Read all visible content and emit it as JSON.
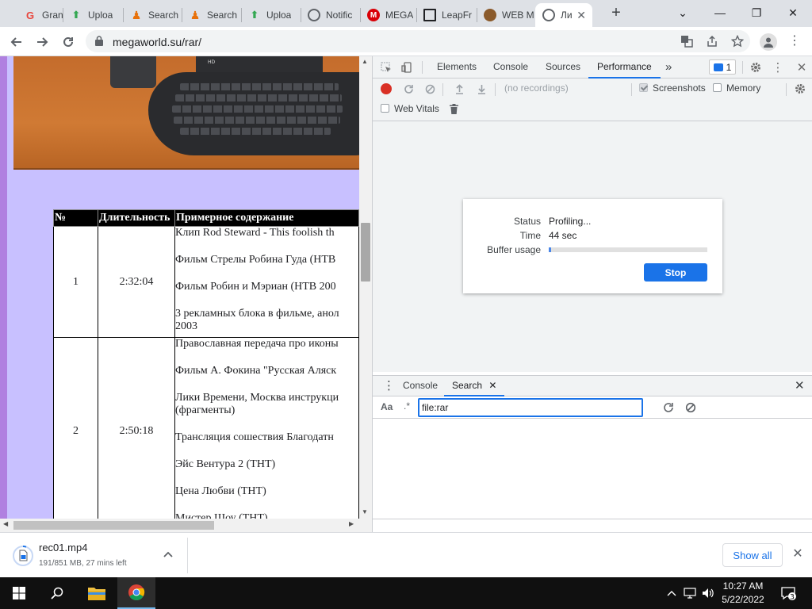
{
  "browser": {
    "tabs": [
      {
        "title": "Grand",
        "favicon": "grand-icon",
        "color": "#e8453c"
      },
      {
        "title": "Uploa",
        "favicon": "upload-icon",
        "color": "#34a853"
      },
      {
        "title": "Search",
        "favicon": "search-person-icon",
        "color": "#e8710a"
      },
      {
        "title": "Search",
        "favicon": "search-person-icon",
        "color": "#e8710a"
      },
      {
        "title": "Uploa",
        "favicon": "upload-icon",
        "color": "#34a853"
      },
      {
        "title": "Notific",
        "favicon": "globe-icon",
        "color": "#5f6368"
      },
      {
        "title": "MEGA",
        "favicon": "mega-icon",
        "color": "#d90007"
      },
      {
        "title": "LeapFr",
        "favicon": "museum-icon",
        "color": "#202124"
      },
      {
        "title": "WEB M",
        "favicon": "eye-icon",
        "color": "#8a5a2b"
      },
      {
        "title": "Ли",
        "favicon": "globe-icon",
        "color": "#5f6368",
        "active": true
      }
    ],
    "url": "megaworld.su/rar/"
  },
  "page": {
    "photo_label": "HD",
    "table": {
      "headers": [
        "№",
        "Длительность",
        "Примерное содержание"
      ],
      "rows": [
        {
          "num": "1",
          "duration": "2:32:04",
          "items": [
            "Клип Rod Steward - This foolish th",
            "Фильм Стрелы Робина Гуда (НТВ",
            "Фильм Робин и Мэриан (НТВ 200",
            "3 рекламных блока в фильме, анол\n2003"
          ]
        },
        {
          "num": "2",
          "duration": "2:50:18",
          "items": [
            "Православная передача про иконы",
            "Фильм А. Фокина \"Русская Аляск",
            "Лики Времени, Москва инструкци\n(фрагменты)",
            "Трансляция сошествия Благодатн",
            "Эйс Вентура 2 (ТНТ)",
            "Цена Любви (ТНТ)",
            "Мистер Шоу (ТНТ)"
          ]
        }
      ]
    }
  },
  "devtools": {
    "tabs": [
      "Elements",
      "Console",
      "Sources",
      "Performance"
    ],
    "active_tab": "Performance",
    "issues_count": "1",
    "recordings_placeholder": "(no recordings)",
    "screenshots_label": "Screenshots",
    "memory_label": "Memory",
    "web_vitals_label": "Web Vitals",
    "status": {
      "status_label": "Status",
      "status_value": "Profiling...",
      "time_label": "Time",
      "time_value": "44 sec",
      "buffer_label": "Buffer usage",
      "buffer_fraction": 0.015,
      "stop_label": "Stop"
    },
    "drawer": {
      "tabs": [
        "Console",
        "Search"
      ],
      "active_tab": "Search",
      "case_label": "Aa",
      "regex_label": ".*",
      "search_value": "file:rar"
    }
  },
  "downloads": {
    "filename": "rec01.mp4",
    "status": "191/851 MB, 27 mins left",
    "show_all_label": "Show all"
  },
  "taskbar": {
    "time": "10:27 AM",
    "date": "5/22/2022",
    "notifications": "3"
  }
}
